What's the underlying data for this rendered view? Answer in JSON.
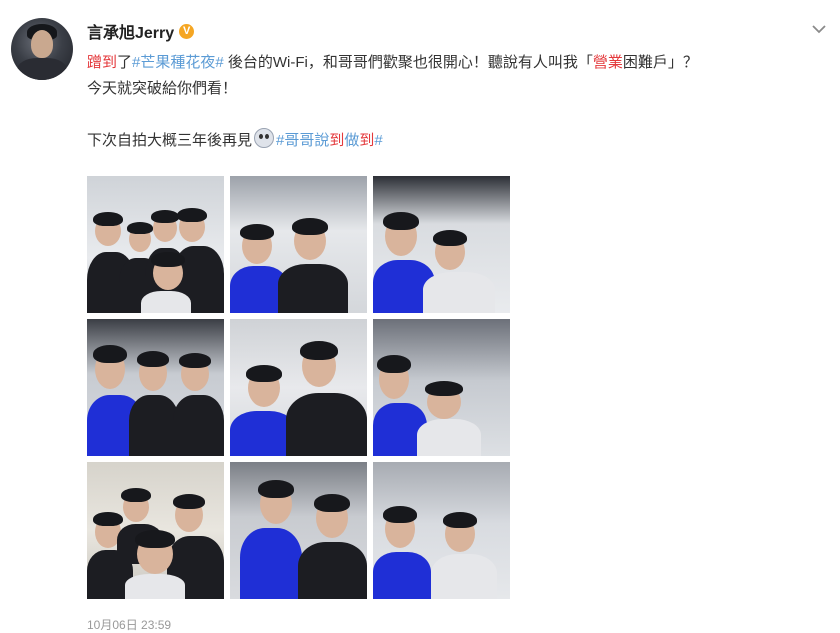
{
  "user": {
    "name": "言承旭Jerry",
    "verified": "V"
  },
  "icons": {
    "avatar": "avatar-photo",
    "verified": "verified-badge-icon",
    "menu": "chevron-down-icon",
    "emoji": "scared-face-emoji-icon"
  },
  "post": {
    "line1": [
      {
        "text": "蹭到",
        "style": "red"
      },
      {
        "text": "了",
        "style": "plain"
      },
      {
        "text": "#芒果種花夜#",
        "style": "blue"
      },
      {
        "text": " 後台的Wi-Fi，和哥哥們歡聚也很開心！聽說有人叫我「",
        "style": "plain"
      },
      {
        "text": "營業",
        "style": "red"
      },
      {
        "text": "困難戶」？",
        "style": "plain"
      }
    ],
    "line2": "今天就突破給你們看！",
    "line3_prefix": "下次自拍大概三年後再見",
    "line3_tag": [
      {
        "text": "#哥哥說",
        "style": "blue"
      },
      {
        "text": "到",
        "style": "red"
      },
      {
        "text": "做",
        "style": "blue"
      },
      {
        "text": "到",
        "style": "red"
      },
      {
        "text": "#",
        "style": "blue"
      }
    ]
  },
  "photos": [
    {
      "label": "group-selfie-1"
    },
    {
      "label": "selfie-2"
    },
    {
      "label": "selfie-3"
    },
    {
      "label": "selfie-4"
    },
    {
      "label": "selfie-5"
    },
    {
      "label": "selfie-6"
    },
    {
      "label": "group-selfie-7"
    },
    {
      "label": "selfie-8"
    },
    {
      "label": "selfie-9"
    }
  ],
  "timestamp": "10月06日 23:59",
  "colors": {
    "accent_red": "#e4393c",
    "accent_blue": "#5b9bd5",
    "verified": "#f5a623"
  }
}
